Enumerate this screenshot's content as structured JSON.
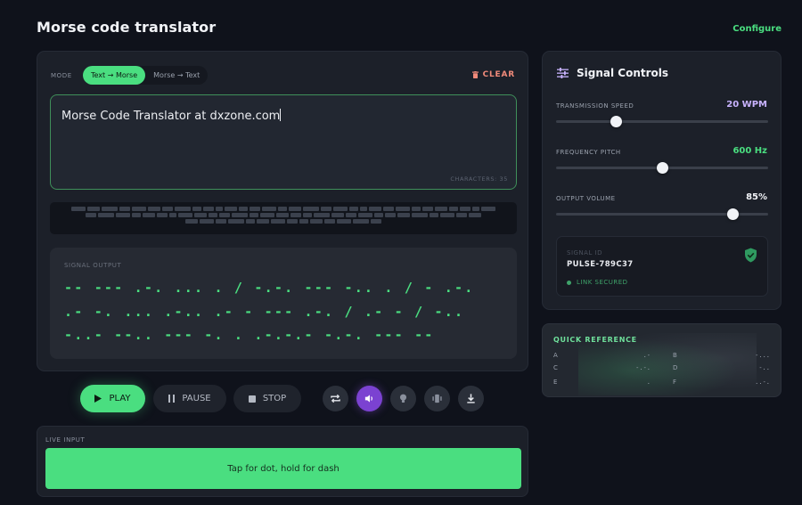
{
  "header": {
    "title": "Morse code translator",
    "configure_label": "Configure"
  },
  "mode": {
    "label": "MODE",
    "options": [
      "Text → Morse",
      "Morse → Text"
    ],
    "selected": "Text → Morse"
  },
  "clear_label": "CLEAR",
  "input": {
    "value": "Morse Code Translator at dxzone.com",
    "char_count": "CHARACTERS: 35"
  },
  "signal_output": {
    "label": "SIGNAL OUTPUT",
    "lines": [
      "-- --- .-. ... . / -.-. --- -.. . / - .-.",
      ".- -. ... .-.. .- - --- .-. / .- - / -..",
      "-..- --.. --- -. . .-.-.- -.-. --- --"
    ]
  },
  "playback": {
    "play_label": "PLAY",
    "pause_label": "PAUSE",
    "stop_label": "STOP",
    "icon_buttons": [
      "loop-icon",
      "sound-icon",
      "light-bulb-icon",
      "vibrate-icon",
      "download-icon"
    ],
    "active_icon": "sound-icon"
  },
  "live_input": {
    "label": "LIVE INPUT",
    "tap_hint": "Tap for dot, hold for dash"
  },
  "controls": {
    "title": "Signal Controls",
    "sliders": [
      {
        "label": "TRANSMISSION SPEED",
        "value_text": "20 WPM",
        "fraction": 0.28,
        "color": "#c9b3ff"
      },
      {
        "label": "FREQUENCY PITCH",
        "value_text": "600 Hz",
        "fraction": 0.5,
        "color": "#4ade80"
      },
      {
        "label": "OUTPUT VOLUME",
        "value_text": "85%",
        "fraction": 0.83,
        "color": "#f1f3f7"
      }
    ],
    "signal_id_label": "SIGNAL ID",
    "signal_id_value": "PULSE-789C37",
    "link_status": "LINK SECURED"
  },
  "quick_reference": {
    "title": "QUICK REFERENCE",
    "entries": [
      {
        "letter": "A",
        "code": ".-"
      },
      {
        "letter": "B",
        "code": "-..."
      },
      {
        "letter": "C",
        "code": "-.-."
      },
      {
        "letter": "D",
        "code": "-.."
      },
      {
        "letter": "E",
        "code": "."
      },
      {
        "letter": "F",
        "code": "..-."
      }
    ]
  },
  "colors": {
    "accent": "#4ade80",
    "active_purple": "#7b42d1",
    "clear_red": "#f08a7a"
  }
}
